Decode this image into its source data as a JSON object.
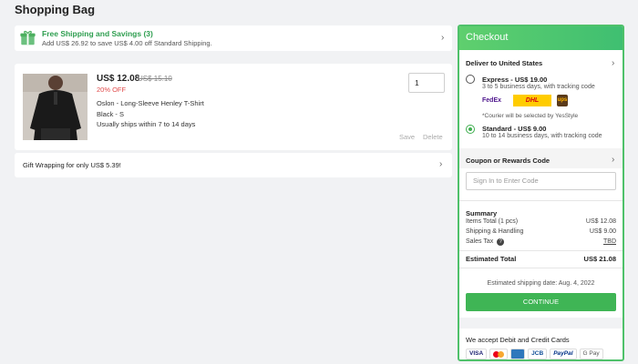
{
  "page": {
    "title": "Shopping Bag"
  },
  "banner": {
    "title": "Free Shipping and Savings (3)",
    "subtitle": "Add US$ 26.92 to save US$ 4.00 off Standard Shipping."
  },
  "cart": {
    "item": {
      "price": "US$ 12.08",
      "old_price": "US$ 15.10",
      "discount": "20% OFF",
      "name": "Oslon - Long-Sleeve Henley T-Shirt",
      "variant": "Black - S",
      "shipping": "Usually ships within 7 to 14 days",
      "quantity": "1",
      "save_label": "Save",
      "delete_label": "Delete"
    },
    "gift_wrap": "Gift Wrapping for only US$ 5.39!"
  },
  "checkout": {
    "header": "Checkout",
    "deliver_to": "Deliver to United States",
    "express": {
      "title": "Express - US$ 19.00",
      "desc": "3 to 5 business days, with tracking code",
      "carriers": [
        "FedEx",
        "DHL",
        "ups"
      ],
      "note": "*Courier will be selected by YesStyle",
      "selected": false
    },
    "standard": {
      "title": "Standard - US$ 9.00",
      "desc": "10 to 14 business days, with tracking code",
      "selected": true
    },
    "coupon": {
      "label": "Coupon or Rewards Code",
      "placeholder": "Sign In to Enter Code"
    },
    "summary": {
      "title": "Summary",
      "rows": [
        {
          "label": "Items Total (1 pcs)",
          "value": "US$ 12.08"
        },
        {
          "label": "Shipping & Handling",
          "value": "US$ 9.00"
        },
        {
          "label": "Sales Tax",
          "value": "TBD"
        }
      ],
      "total_label": "Estimated Total",
      "total_value": "US$ 21.08"
    },
    "ship_date": "Estimated shipping date: Aug. 4, 2022",
    "continue_label": "CONTINUE"
  },
  "payment": {
    "title": "We accept Debit and Credit Cards",
    "cards": [
      "VISA",
      "Mastercard",
      "AMEX",
      "JCB",
      "PayPal",
      "G Pay"
    ]
  },
  "colors": {
    "accent": "#3fb555",
    "discount": "#e04a4a"
  },
  "icons": [
    "gift-box-icon",
    "chevron-right-icon",
    "help-icon"
  ]
}
